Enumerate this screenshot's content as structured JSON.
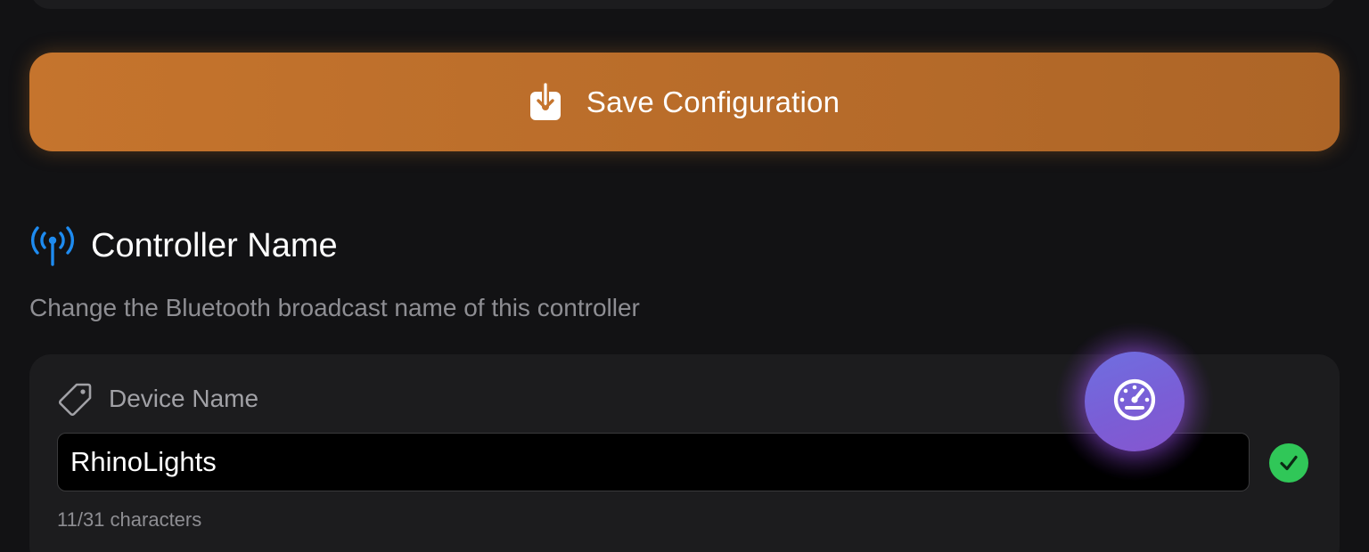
{
  "toolbar": {
    "save_label": "Save Configuration",
    "save_icon": "save-download-icon",
    "accent_color": "#c5742d"
  },
  "section": {
    "title": "Controller Name",
    "subtitle": "Change the Bluetooth broadcast name of this controller",
    "icon": "antenna-broadcast-icon",
    "icon_color": "#1e8bf0"
  },
  "device_name": {
    "label": "Device Name",
    "label_icon": "tag-icon",
    "value": "RhinoLights",
    "char_count": "11/31 characters",
    "valid_color": "#30c758"
  },
  "fab": {
    "icon": "speedometer-icon",
    "color": "#7a5ed6"
  }
}
